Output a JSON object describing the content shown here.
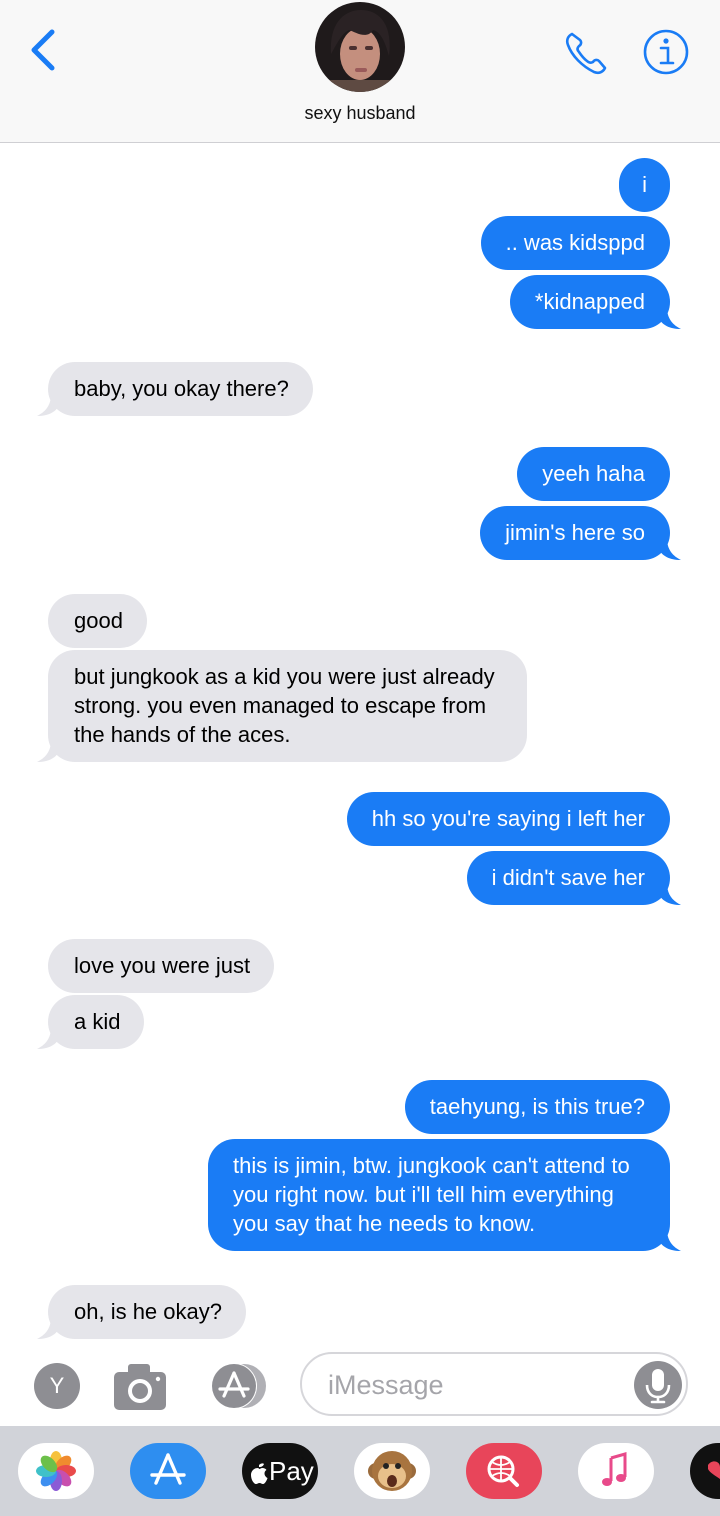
{
  "header": {
    "contact_name": "sexy husband",
    "icons": [
      "back-chevron-icon",
      "avatar",
      "phone-icon",
      "info-icon"
    ],
    "accent_color": "#1a7cf5"
  },
  "messages": [
    {
      "dir": "out",
      "text": "i"
    },
    {
      "dir": "out",
      "text": ".. was kidsppd"
    },
    {
      "dir": "out",
      "text": "*kidnapped"
    },
    {
      "dir": "in",
      "text": "baby, you okay there?"
    },
    {
      "dir": "out",
      "text": "yeeh haha"
    },
    {
      "dir": "out",
      "text": "jimin's here so"
    },
    {
      "dir": "in",
      "text": "good"
    },
    {
      "dir": "in",
      "lines": [
        "but jungkook as a kid you were just already",
        "strong. you even managed to escape from",
        "the hands of the aces."
      ]
    },
    {
      "dir": "out",
      "text": "hh so you're saying i left her"
    },
    {
      "dir": "out",
      "text": "i didn't save her"
    },
    {
      "dir": "in",
      "text": "love you were just"
    },
    {
      "dir": "in",
      "text": "a kid"
    },
    {
      "dir": "out",
      "text": "taehyung, is this true?"
    },
    {
      "dir": "out",
      "lines": [
        "this is jimin, btw. jungkook can't attend to",
        "you right now. but i'll tell him everything",
        "you say that he needs to know."
      ]
    },
    {
      "dir": "in",
      "text": "oh, is he okay?"
    }
  ],
  "input_bar": {
    "app_button_letter": "Y",
    "placeholder": "iMessage",
    "icons": [
      "camera-icon",
      "app-store-icon",
      "microphone-icon"
    ]
  },
  "app_drawer": {
    "apple_pay_label": "Pay",
    "apps": [
      "photos-icon",
      "app-store-icon",
      "apple-pay-icon",
      "animoji-monkey-icon",
      "web-search-icon",
      "music-icon",
      "heart-app-icon"
    ]
  },
  "colors": {
    "outgoing_bubble": "#1a7cf5",
    "incoming_bubble": "#e5e5ea",
    "header_bg": "#f8f8f8",
    "drawer_bg": "#d1d3d9"
  }
}
